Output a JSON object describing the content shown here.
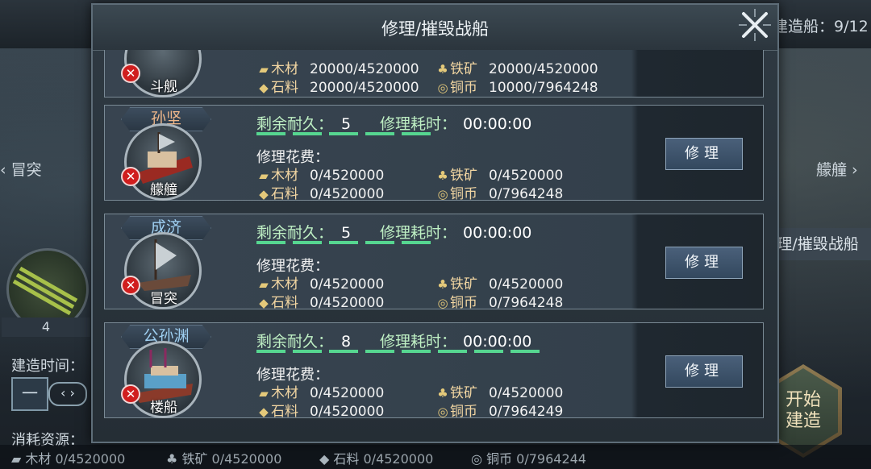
{
  "background": {
    "header_ship_count": "建造船：9/12",
    "left_ship_label": "冒突",
    "right_ship_label": "艨艟",
    "left_ship_count": "4",
    "build_time_label": "建造时间：",
    "time_value": "一",
    "arrows": "‹ ›",
    "consume_label": "消耗资源：",
    "repair_destroy_button": "理/摧毁战船",
    "start_build_button": "开始\n建造",
    "bottom_resources": [
      {
        "icon": "wood-icon",
        "name": "木材",
        "value": "0/4520000"
      },
      {
        "icon": "iron-icon",
        "name": "铁矿",
        "value": "0/4520000"
      },
      {
        "icon": "stone-icon",
        "name": "石料",
        "value": "0/4520000"
      },
      {
        "icon": "copper-icon",
        "name": "铜币",
        "value": "0/7964244"
      }
    ]
  },
  "dialog": {
    "title": "修理/摧毁战船",
    "partial_card": {
      "ship": "斗舰",
      "resources": [
        {
          "name": "木材",
          "value": "20000/4520000"
        },
        {
          "name": "铁矿",
          "value": "20000/4520000"
        },
        {
          "name": "石料",
          "value": "20000/4520000"
        },
        {
          "name": "铜币",
          "value": "10000/7964248"
        }
      ]
    },
    "labels": {
      "durability": "剩余耐久：",
      "repair_time": "修理耗时：",
      "cost": "修理花费：",
      "repair_button": "修理"
    },
    "cards": [
      {
        "general": "孙坚",
        "general_color": "#f0b88a",
        "ship": "艨艟",
        "durability": "5",
        "time": "00:00:00",
        "durability_bars": 5,
        "resources": [
          {
            "name": "木材",
            "value": "0/4520000"
          },
          {
            "name": "铁矿",
            "value": "0/4520000"
          },
          {
            "name": "石料",
            "value": "0/4520000"
          },
          {
            "name": "铜币",
            "value": "0/7964248"
          }
        ]
      },
      {
        "general": "成济",
        "general_color": "#9fd0f2",
        "ship": "冒突",
        "durability": "5",
        "time": "00:00:00",
        "durability_bars": 5,
        "resources": [
          {
            "name": "木材",
            "value": "0/4520000"
          },
          {
            "name": "铁矿",
            "value": "0/4520000"
          },
          {
            "name": "石料",
            "value": "0/4520000"
          },
          {
            "name": "铜币",
            "value": "0/7964248"
          }
        ]
      },
      {
        "general": "公孙渊",
        "general_color": "#9fd0f2",
        "ship": "楼船",
        "durability": "8",
        "time": "00:00:00",
        "durability_bars": 8,
        "resources": [
          {
            "name": "木材",
            "value": "0/4520000"
          },
          {
            "name": "铁矿",
            "value": "0/4520000"
          },
          {
            "name": "石料",
            "value": "0/4520000"
          },
          {
            "name": "铜币",
            "value": "0/7964249"
          }
        ]
      }
    ]
  }
}
